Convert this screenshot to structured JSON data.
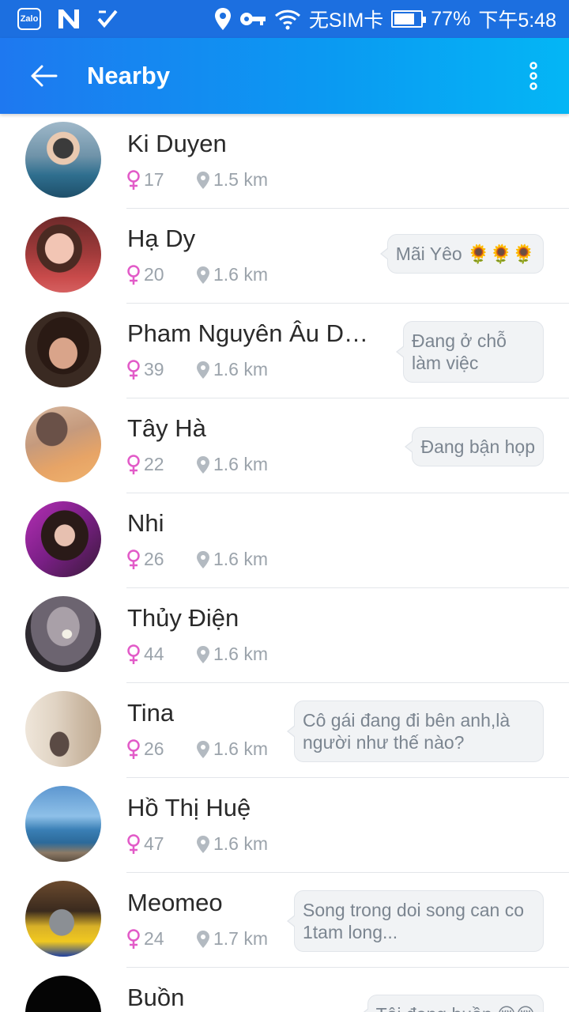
{
  "status_bar": {
    "network_text": "无SIM卡",
    "battery_percent": "77%",
    "battery_level": 0.77,
    "time": "下午5:48",
    "icons": [
      "zalo-icon",
      "n-app-icon",
      "checkmark-app-icon",
      "location-icon",
      "key-icon",
      "wifi-icon",
      "battery-icon"
    ],
    "zalo_label": "Zalo"
  },
  "app_bar": {
    "title": "Nearby",
    "back_icon": "arrow-left-icon",
    "more_icon": "more-vertical-icon"
  },
  "colors": {
    "appbar_start": "#1e78f0",
    "appbar_end": "#04b6f5",
    "female_icon": "#e25bc8",
    "meta_text": "#9ba3ab"
  },
  "people": [
    {
      "name": "Ki Duyen",
      "age": "17",
      "distance": "1.5 km",
      "status": ""
    },
    {
      "name": "Hạ Dy",
      "age": "20",
      "distance": "1.6 km",
      "status": "Mãi Yêo 🌻🌻🌻"
    },
    {
      "name": "Pham Nguyên Âu Dương",
      "age": "39",
      "distance": "1.6 km",
      "status": "Đang ở chỗ làm việc"
    },
    {
      "name": "Tây Hà",
      "age": "22",
      "distance": "1.6 km",
      "status": "Đang bận họp"
    },
    {
      "name": "Nhi",
      "age": "26",
      "distance": "1.6 km",
      "status": ""
    },
    {
      "name": "Thủy Điện",
      "age": "44",
      "distance": "1.6 km",
      "status": ""
    },
    {
      "name": "Tina",
      "age": "26",
      "distance": "1.6 km",
      "status": "Cô gái đang đi bên anh,là người như thế nào?"
    },
    {
      "name": "Hồ Thị Huệ",
      "age": "47",
      "distance": "1.6 km",
      "status": ""
    },
    {
      "name": "Meomeo",
      "age": "24",
      "distance": "1.7 km",
      "status": "Song trong doi song can co 1tam long..."
    },
    {
      "name": "Buồn",
      "age": "",
      "distance": "",
      "status": "Tôi đang buồn 😢😢"
    }
  ]
}
